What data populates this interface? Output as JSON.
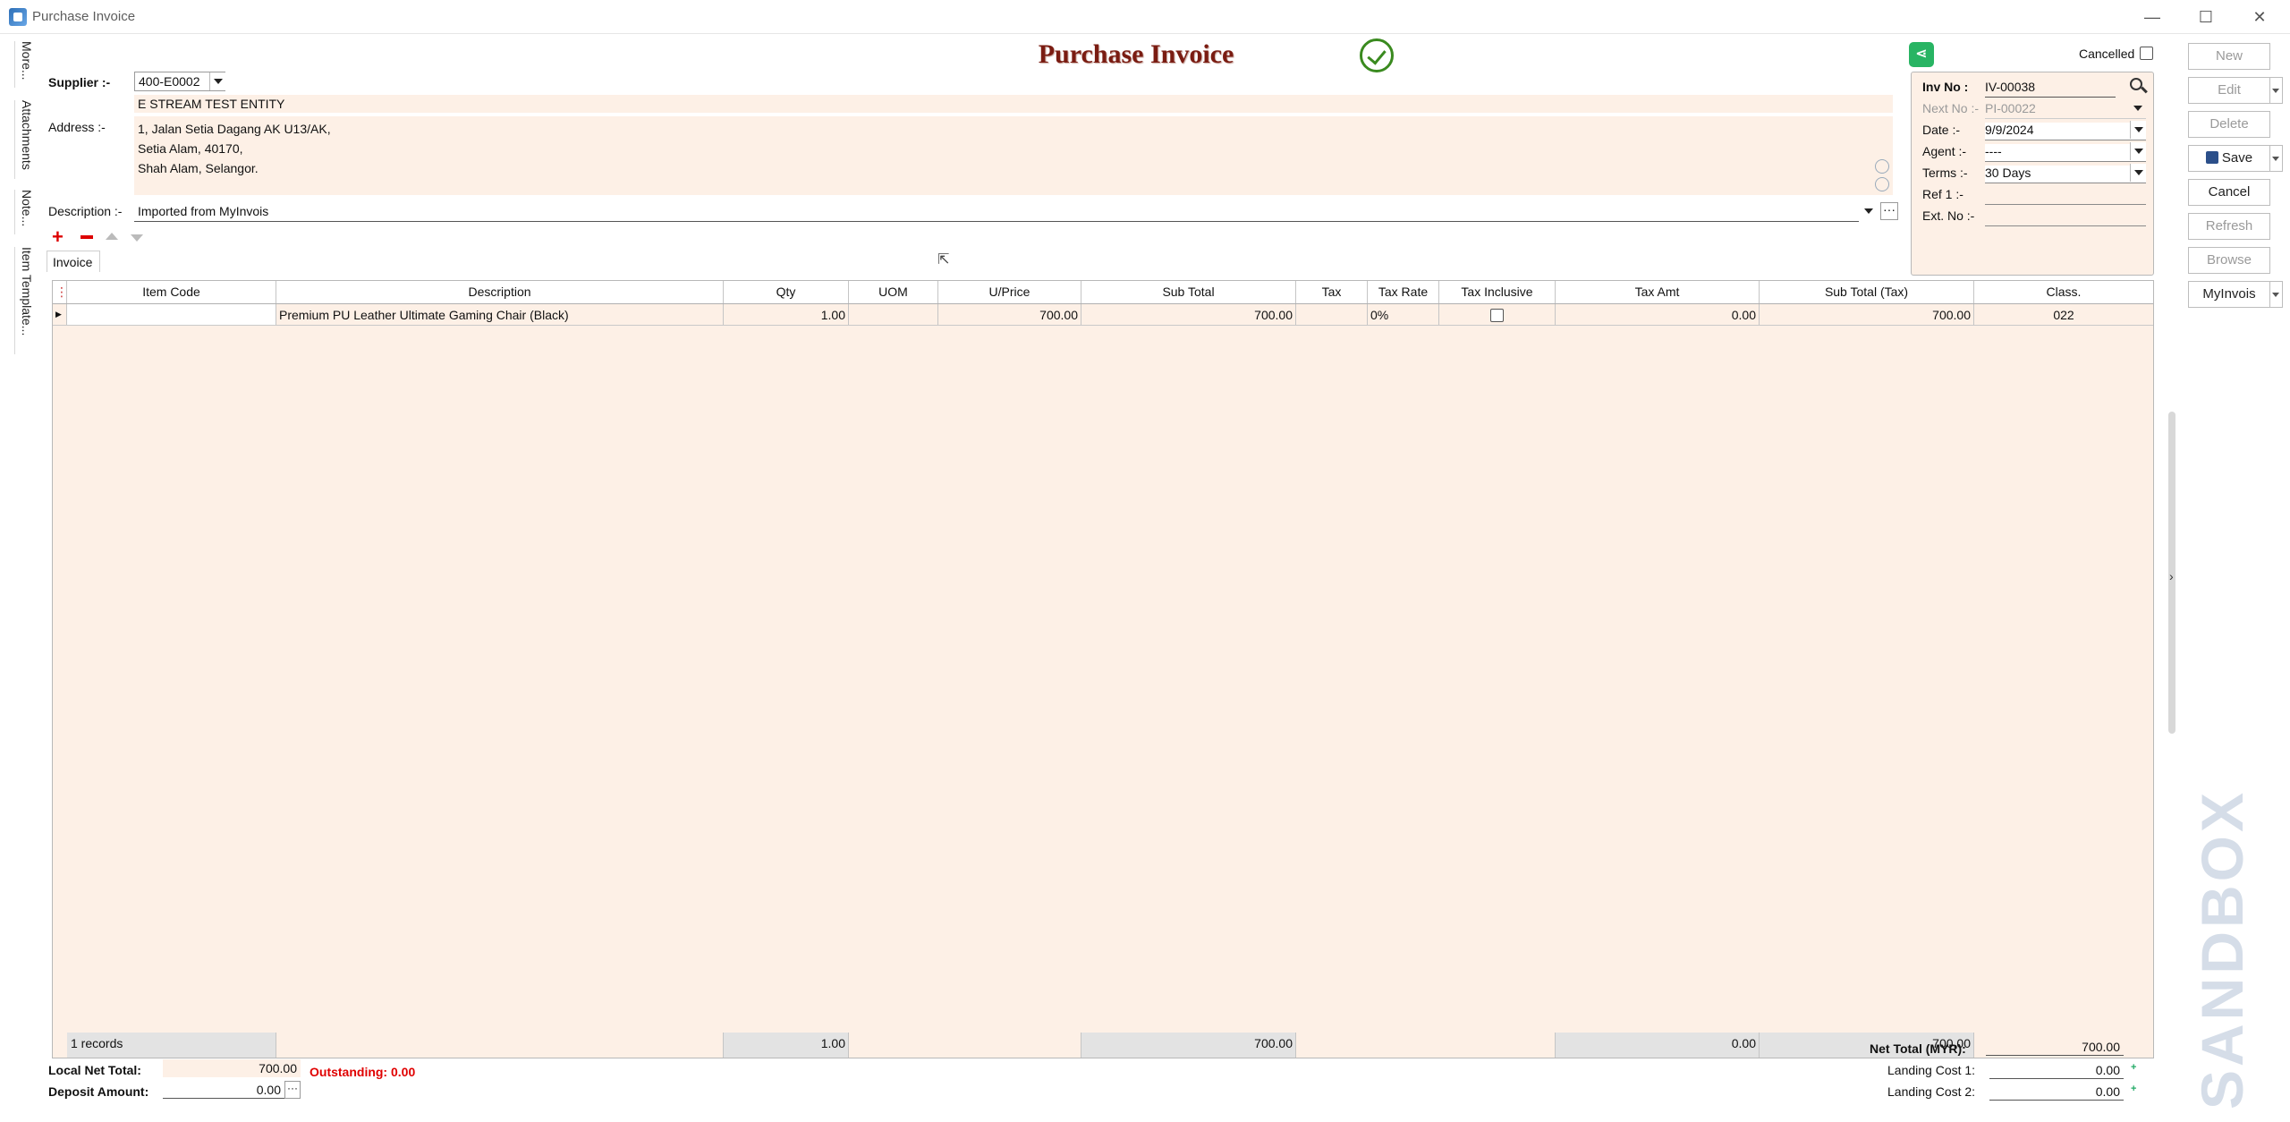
{
  "window": {
    "title": "Purchase Invoice",
    "minimize": "—",
    "maximize": "☐",
    "close": "✕"
  },
  "side_tabs": [
    "More...",
    "Attachments",
    "Note...",
    "Item Template..."
  ],
  "form": {
    "heading": "Purchase Invoice",
    "supplier_label": "Supplier :-",
    "supplier_code": "400-E0002",
    "supplier_name": "E STREAM TEST ENTITY",
    "address_label": "Address :-",
    "address_lines": [
      "1, Jalan Setia Dagang AK U13/AK,",
      "Setia Alam, 40170,",
      "Shah Alam, Selangor."
    ],
    "description_label": "Description :-",
    "description": "Imported from MyInvois",
    "cancelled_label": "Cancelled"
  },
  "info": {
    "inv_no_label": "Inv No :",
    "inv_no": "IV-00038",
    "next_no_label": "Next No :-",
    "next_no": "PI-00022",
    "date_label": "Date :-",
    "date": "9/9/2024",
    "agent_label": "Agent :-",
    "agent": "----",
    "terms_label": "Terms :-",
    "terms": "30 Days",
    "ref1_label": "Ref 1 :-",
    "ref1": "",
    "ext_no_label": "Ext. No :-",
    "ext_no": ""
  },
  "grid": {
    "tab": "Invoice",
    "columns": [
      "Item Code",
      "Description",
      "Qty",
      "UOM",
      "U/Price",
      "Sub Total",
      "Tax",
      "Tax Rate",
      "Tax Inclusive",
      "Tax Amt",
      "Sub Total (Tax)",
      "Class."
    ],
    "rows": [
      {
        "item_code": "",
        "description": "Premium PU Leather Ultimate Gaming Chair (Black)",
        "qty": "1.00",
        "uom": "",
        "uprice": "700.00",
        "subtotal": "700.00",
        "tax": "",
        "tax_rate": "0%",
        "tax_inclusive": false,
        "tax_amt": "0.00",
        "subtotal_tax": "700.00",
        "class": "022"
      }
    ],
    "footer": {
      "records": "1 records",
      "qty": "1.00",
      "subtotal": "700.00",
      "tax_amt": "0.00",
      "subtotal_tax": "700.00"
    }
  },
  "totals": {
    "local_net_total_label": "Local Net Total:",
    "local_net_total": "700.00",
    "outstanding": "Outstanding: 0.00",
    "deposit_label": "Deposit Amount:",
    "deposit": "0.00",
    "net_total_label": "Net Total (MYR):",
    "net_total": "700.00",
    "landing1_label": "Landing Cost 1:",
    "landing1": "0.00",
    "landing2_label": "Landing Cost 2:",
    "landing2": "0.00"
  },
  "actions": {
    "new": "New",
    "edit": "Edit",
    "delete": "Delete",
    "save": "Save",
    "cancel": "Cancel",
    "refresh": "Refresh",
    "browse": "Browse",
    "myinvois": "MyInvois"
  },
  "watermark": "SANDBOX",
  "colors": {
    "field_bg": "#fdf0e6",
    "heading": "#7a1c12",
    "outstanding": "#e00000",
    "check": "#3a8a1f",
    "share": "#28b463"
  }
}
